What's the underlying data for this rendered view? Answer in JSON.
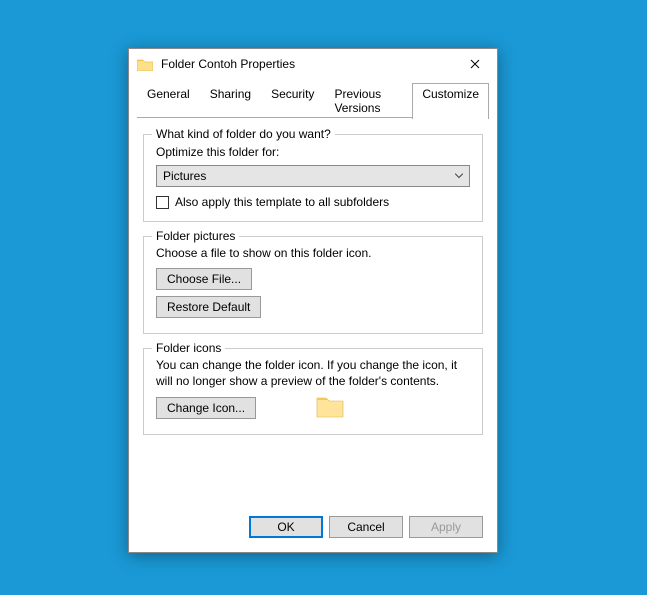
{
  "window": {
    "title": "Folder Contoh Properties"
  },
  "tabs": {
    "t0": "General",
    "t1": "Sharing",
    "t2": "Security",
    "t3": "Previous Versions",
    "t4": "Customize"
  },
  "group1": {
    "legend": "What kind of folder do you want?",
    "optimize_label": "Optimize this folder for:",
    "optimize_value": "Pictures",
    "subfolders_label": "Also apply this template to all subfolders"
  },
  "group2": {
    "legend": "Folder pictures",
    "help": "Choose a file to show on this folder icon.",
    "choose_btn": "Choose File...",
    "restore_btn": "Restore Default"
  },
  "group3": {
    "legend": "Folder icons",
    "help": "You can change the folder icon. If you change the icon, it will no longer show a preview of the folder's contents.",
    "change_btn": "Change Icon..."
  },
  "buttons": {
    "ok": "OK",
    "cancel": "Cancel",
    "apply": "Apply"
  }
}
